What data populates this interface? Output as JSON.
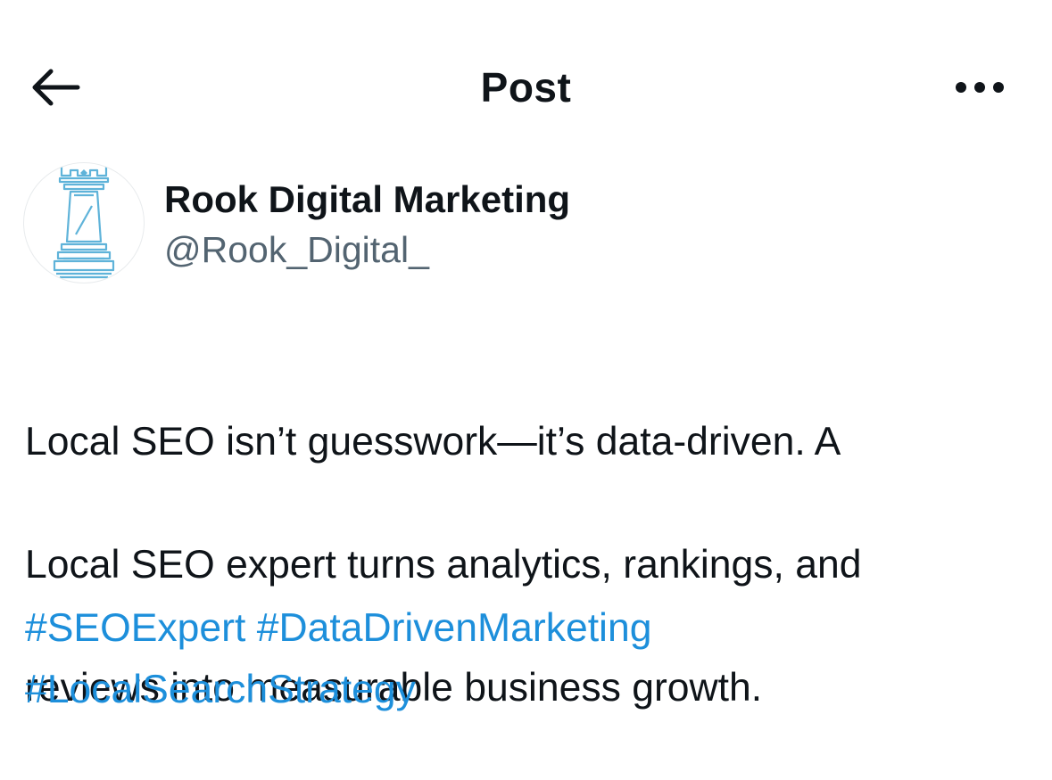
{
  "header": {
    "title": "Post",
    "back_icon": "arrow-left-icon",
    "more_icon": "ellipsis-horizontal-icon"
  },
  "author": {
    "name": "Rook Digital Marketing",
    "handle": "@Rook_Digital_",
    "avatar_icon": "chess-rook-logo"
  },
  "post": {
    "text_lines": [
      "Local SEO isn’t guesswork—it’s data-driven. A",
      "Local SEO expert turns analytics, rankings, and",
      "reviews into measurable business growth."
    ],
    "hashtags": [
      "#SEOExpert",
      "#DataDrivenMarketing",
      "#LocalSearchStrategy"
    ]
  },
  "colors": {
    "text": "#0f1419",
    "secondary_text": "#536471",
    "link": "#1d8fdb",
    "logo": "#5fb3d9"
  }
}
